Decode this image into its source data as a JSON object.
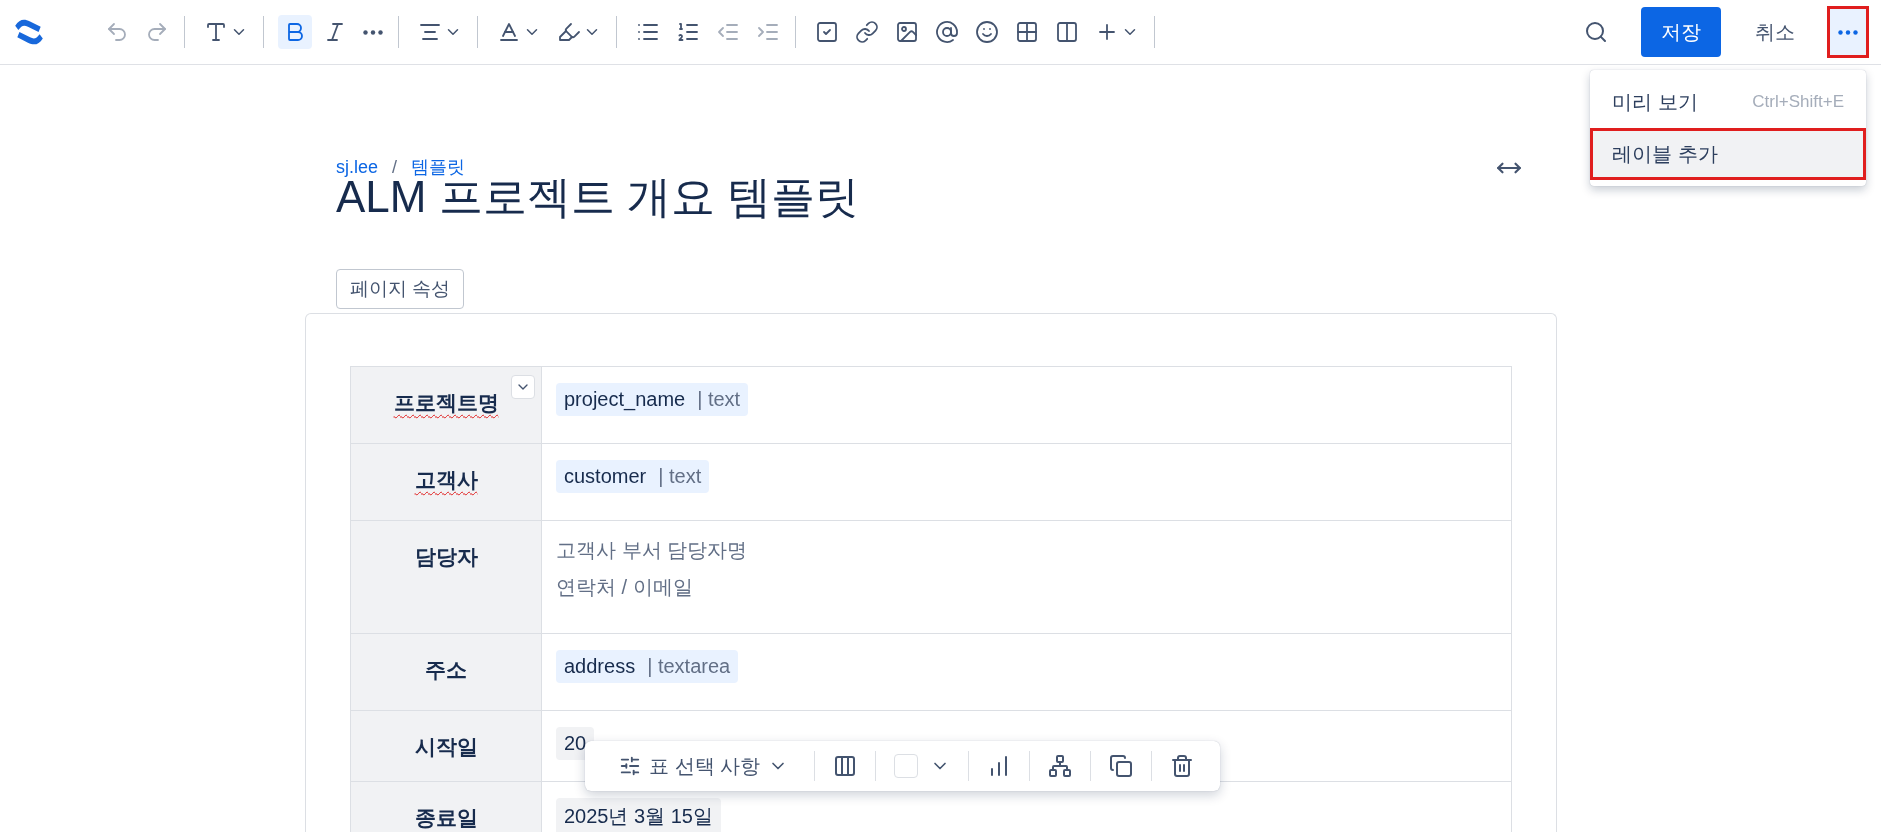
{
  "toolbar": {
    "groups": [
      [
        {
          "kind": "undo",
          "disabled": true
        },
        {
          "kind": "redo",
          "disabled": true
        }
      ],
      [
        {
          "kind": "textstyle",
          "dropdown": true
        }
      ],
      [
        {
          "kind": "bold",
          "selected": true
        },
        {
          "kind": "italic",
          "selected": false
        },
        {
          "kind": "more",
          "selected": false
        }
      ],
      [
        {
          "kind": "align",
          "dropdown": true
        }
      ],
      [
        {
          "kind": "textcolor",
          "dropdown": true
        },
        {
          "kind": "highlight",
          "dropdown": true
        }
      ],
      [
        {
          "kind": "bullets"
        },
        {
          "kind": "numbers"
        },
        {
          "kind": "outdent",
          "disabled": true
        },
        {
          "kind": "indent",
          "disabled": true
        }
      ],
      [
        {
          "kind": "task"
        },
        {
          "kind": "link"
        },
        {
          "kind": "image"
        },
        {
          "kind": "mention"
        },
        {
          "kind": "emoji"
        },
        {
          "kind": "table"
        },
        {
          "kind": "layout"
        },
        {
          "kind": "insert",
          "dropdown": true
        }
      ]
    ],
    "save": "저장",
    "cancel": "취소",
    "more_highlighted": true
  },
  "menu": {
    "items": [
      {
        "label": "미리 보기",
        "shortcut": "Ctrl+Shift+E",
        "selected": false,
        "highlighted": false
      },
      {
        "label": "레이블 추가",
        "selected": true,
        "highlighted": true
      }
    ]
  },
  "breadcrumb": {
    "items": [
      "sj.lee",
      "템플릿"
    ],
    "separator": "/"
  },
  "title": "ALM 프로젝트 개요 템플릿",
  "page_properties": "페이지 속성",
  "table": {
    "rows": [
      {
        "label": "프로젝트명",
        "misspelled": true,
        "menu": true,
        "kind": "field",
        "name": "project_name",
        "type": "| text"
      },
      {
        "label": "고객사",
        "misspelled": true,
        "kind": "field",
        "name": "customer",
        "type": "| text"
      },
      {
        "label": "담당자",
        "misspelled": false,
        "kind": "lines",
        "lines": [
          "고객사 부서 담당자명",
          "연락처 / 이메일"
        ]
      },
      {
        "label": "주소",
        "misspelled": false,
        "kind": "field",
        "name": "address",
        "type": "| textarea"
      },
      {
        "label": "시작일",
        "misspelled": false,
        "kind": "date",
        "value": "20"
      },
      {
        "label": "종료일",
        "misspelled": false,
        "kind": "date",
        "value": "2025년 3월 15일"
      }
    ]
  },
  "table_toolbar": {
    "options": "표 선택 사항",
    "items": [
      {
        "kind": "columns"
      },
      {
        "kind": "color"
      },
      {
        "kind": "numbered"
      },
      {
        "kind": "sort"
      },
      {
        "kind": "copy"
      },
      {
        "kind": "delete"
      }
    ]
  }
}
